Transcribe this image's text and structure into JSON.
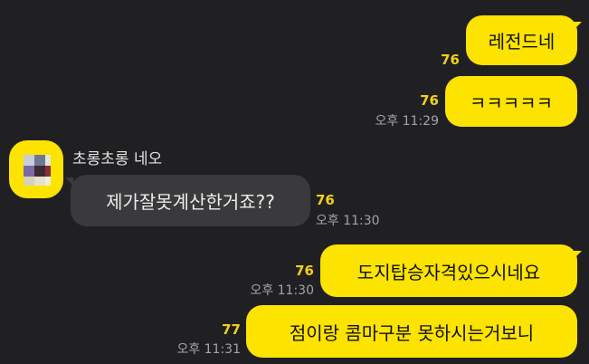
{
  "chat": {
    "messages": [
      {
        "sender": "me",
        "text": "레전드네",
        "unread": "76"
      },
      {
        "sender": "me",
        "text": "ㅋㅋㅋㅋㅋ",
        "unread": "76",
        "time": "오후 11:29"
      },
      {
        "sender": "other",
        "name": "초롱초롱 네오",
        "text": "제가잘못계산한거죠??",
        "unread": "76",
        "time": "오후 11:30"
      },
      {
        "sender": "me",
        "text": "도지탑승자격있으시네요",
        "unread": "76",
        "time": "오후 11:30"
      },
      {
        "sender": "me",
        "text": "점이랑 콤마구분 못하시는거보니",
        "unread": "77",
        "time": "오후 11:31"
      }
    ]
  },
  "colors": {
    "background": "#202022",
    "my_bubble": "#fce300",
    "other_bubble": "#3a3a3c",
    "unread_count": "#f2d11a",
    "timestamp": "#a3a3a8"
  },
  "icons": {
    "avatar": "pixelated-profile-image"
  }
}
